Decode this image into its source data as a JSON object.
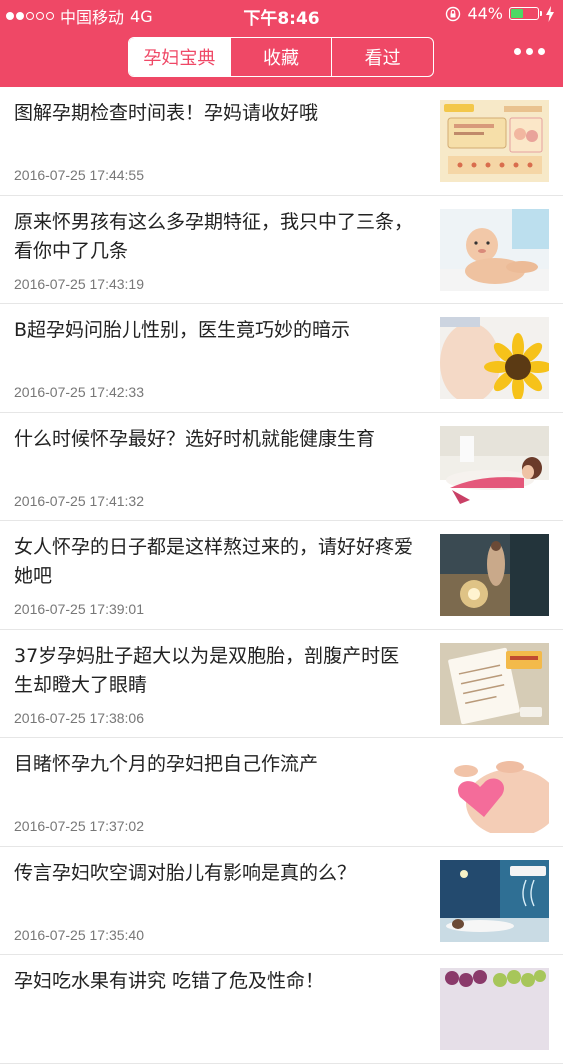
{
  "status_bar": {
    "carrier": "中国移动",
    "network": "4G",
    "time": "下午8:46",
    "battery_percent": "44%",
    "battery_level": 0.44
  },
  "tabs": [
    {
      "label": "孕妇宝典",
      "active": true
    },
    {
      "label": "收藏",
      "active": false
    },
    {
      "label": "看过",
      "active": false
    }
  ],
  "colors": {
    "accent": "#ef4866"
  },
  "articles": [
    {
      "title": "图解孕期检查时间表！孕妈请收好哦",
      "time": "2016-07-25 17:44:55"
    },
    {
      "title": "原来怀男孩有这么多孕期特征，我只中了三条，看你中了几条",
      "time": "2016-07-25 17:43:19"
    },
    {
      "title": "B超孕妈问胎儿性别，医生竟巧妙的暗示",
      "time": "2016-07-25 17:42:33"
    },
    {
      "title": "什么时候怀孕最好？选好时机就能健康生育",
      "time": "2016-07-25 17:41:32"
    },
    {
      "title": "女人怀孕的日子都是这样熬过来的，请好好疼爱她吧",
      "time": "2016-07-25 17:39:01"
    },
    {
      "title": "37岁孕妈肚子超大以为是双胞胎，剖腹产时医生却瞪大了眼睛",
      "time": "2016-07-25 17:38:06"
    },
    {
      "title": "目睹怀孕九个月的孕妇把自己作流产",
      "time": "2016-07-25 17:37:02"
    },
    {
      "title": "传言孕妇吹空调对胎儿有影响是真的么？",
      "time": "2016-07-25 17:35:40"
    },
    {
      "title": "孕妇吃水果有讲究 吃错了危及性命！",
      "time": ""
    }
  ]
}
